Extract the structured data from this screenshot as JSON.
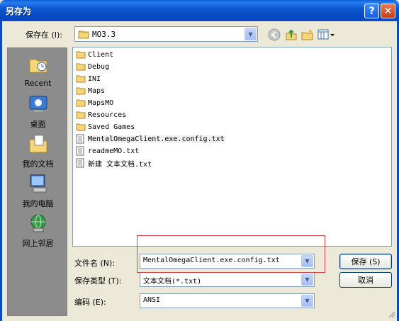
{
  "window": {
    "title": "另存为",
    "help_glyph": "?",
    "close_glyph": "✕"
  },
  "savein": {
    "label": "保存在 (I):",
    "value": "MO3.3"
  },
  "places": [
    {
      "label": "Recent",
      "icon": "recent-folder-icon"
    },
    {
      "label": "桌面",
      "icon": "desktop-icon"
    },
    {
      "label": "我的文档",
      "icon": "my-documents-icon"
    },
    {
      "label": "我的电脑",
      "icon": "my-computer-icon"
    },
    {
      "label": "网上邻居",
      "icon": "network-places-icon"
    }
  ],
  "files": [
    {
      "name": "Client",
      "type": "folder"
    },
    {
      "name": "Debug",
      "type": "folder"
    },
    {
      "name": "INI",
      "type": "folder"
    },
    {
      "name": "Maps",
      "type": "folder"
    },
    {
      "name": "MapsMO",
      "type": "folder"
    },
    {
      "name": "Resources",
      "type": "folder"
    },
    {
      "name": "Saved Games",
      "type": "folder"
    },
    {
      "name": "MentalOmegaClient.exe.config.txt",
      "type": "text"
    },
    {
      "name": "readmeMO.txt",
      "type": "text"
    },
    {
      "name": "新建 文本文档.txt",
      "type": "text"
    }
  ],
  "form": {
    "filename_label": "文件名 (N):",
    "filename_value": "MentalOmegaClient.exe.config.txt",
    "savetype_label": "保存类型 (T):",
    "savetype_value": "文本文档(*.txt)",
    "encoding_label": "编码 (E):",
    "encoding_value": "ANSI",
    "save_button": "保存 (S)",
    "cancel_button": "取消"
  },
  "colors": {
    "title_bar": "#0a4ac4",
    "dialog_bg": "#ece9d8",
    "places_bg": "#8c8c8c",
    "highlight_box": "#d84040"
  }
}
